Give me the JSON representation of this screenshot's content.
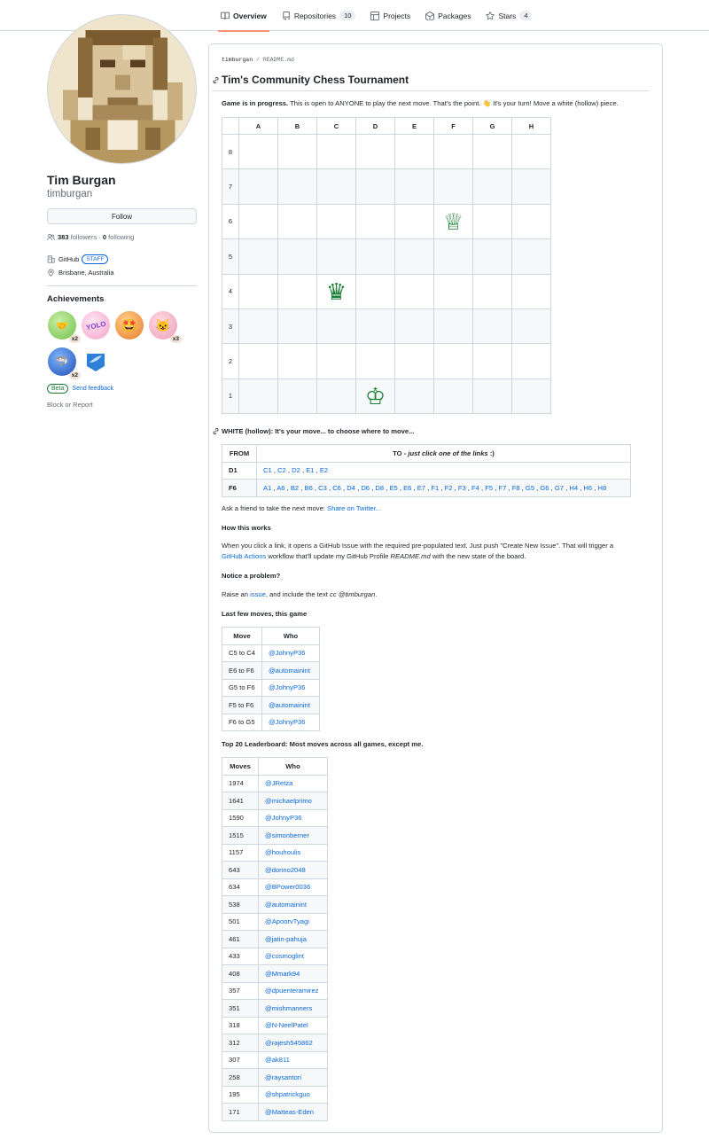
{
  "tabs": [
    {
      "label": "Overview",
      "icon": "book-icon",
      "count": ""
    },
    {
      "label": "Repositories",
      "icon": "repo-icon",
      "count": "10"
    },
    {
      "label": "Projects",
      "icon": "table-icon",
      "count": ""
    },
    {
      "label": "Packages",
      "icon": "package-icon",
      "count": ""
    },
    {
      "label": "Stars",
      "icon": "star-icon",
      "count": "4"
    }
  ],
  "profile": {
    "name": "Tim Burgan",
    "login": "timburgan",
    "follow_label": "Follow",
    "followers_count": "383",
    "followers_label": "followers",
    "sep": "·",
    "following_count": "0",
    "following_label": "following",
    "org": "GitHub",
    "staff_label": "STAFF",
    "location": "Brisbane, Australia",
    "achievements_title": "Achievements",
    "badges": [
      {
        "label": "x2",
        "text": "",
        "color": "#9fd67a"
      },
      {
        "label": "",
        "text": "YOLO",
        "color": "#f7c8e0"
      },
      {
        "label": "",
        "text": "",
        "color": "#f4a65a"
      },
      {
        "label": "x3",
        "text": "",
        "color": "#f0b8c8"
      },
      {
        "label": "x2",
        "text": "",
        "color": "#3b78d8"
      },
      {
        "label": "",
        "text": "",
        "color": "#ffffff"
      }
    ],
    "beta_label": "Beta",
    "feedback_label": "Send feedback",
    "block_label": "Block or Report"
  },
  "readme": {
    "crumb_user": "timburgan",
    "crumb_sep": "/",
    "crumb_file": "README.md",
    "title": "Tim's Community Chess Tournament",
    "status_bold": "Game is in progress.",
    "status_text": " This is open to ANYONE to play the next move. That's the point. 👋 It's your turn! Move a white (hollow) piece.",
    "board": {
      "files": [
        "A",
        "B",
        "C",
        "D",
        "E",
        "F",
        "G",
        "H"
      ],
      "ranks": [
        "8",
        "7",
        "6",
        "5",
        "4",
        "3",
        "2",
        "1"
      ],
      "pieces": [
        {
          "square": "F6",
          "glyph": "♕"
        },
        {
          "square": "C4",
          "glyph": "♛"
        },
        {
          "square": "D1",
          "glyph": "♔"
        }
      ]
    },
    "move_heading": "WHITE (hollow): It's your move... to choose where to move...",
    "moves_table": {
      "from_header": "FROM",
      "to_header_prefix": "TO - ",
      "to_header_em": "just click one of the links",
      "to_header_suffix": " :)",
      "rows": [
        {
          "from": "D1",
          "to": [
            "C1",
            "C2",
            "D2",
            "E1",
            "E2"
          ]
        },
        {
          "from": "F6",
          "to": [
            "A1",
            "A6",
            "B2",
            "B6",
            "C3",
            "C6",
            "D4",
            "D6",
            "D8",
            "E5",
            "E6",
            "E7",
            "F1",
            "F2",
            "F3",
            "F4",
            "F5",
            "F7",
            "F8",
            "G5",
            "G6",
            "G7",
            "H4",
            "H6",
            "H8"
          ]
        }
      ]
    },
    "share_text": "Ask a friend to take the next move: ",
    "share_link": "Share on Twitter...",
    "how_title": "How this works",
    "how_text_1": "When you click a link, it opens a GitHub Issue with the required pre-populated text. Just push \"Create New Issue\". That will trigger a",
    "how_link": "GitHub Actions",
    "how_text_2": " workflow that'll update my GitHub Profile ",
    "how_em": "README.md",
    "how_text_3": " with the new state of the board.",
    "problem_title": "Notice a problem?",
    "problem_text_1": "Raise an ",
    "problem_link": "issue",
    "problem_text_2": ", and include the text ",
    "problem_em": "cc @timburgan",
    "problem_text_3": ".",
    "last_title": "Last few moves, this game",
    "last_headers": [
      "Move",
      "Who"
    ],
    "last_moves": [
      {
        "move": "C5 to C4",
        "who": "@JohnyP36"
      },
      {
        "move": "E6 to F6",
        "who": "@automainint"
      },
      {
        "move": "G5 to F6",
        "who": "@JohnyP36"
      },
      {
        "move": "F5 to F6",
        "who": "@automainint"
      },
      {
        "move": "F6 to G5",
        "who": "@JohnyP36"
      }
    ],
    "lead_title": "Top 20 Leaderboard: Most moves across all games, except me.",
    "lead_headers": [
      "Moves",
      "Who"
    ],
    "leaderboard": [
      {
        "moves": "1974",
        "who": "@JRetza"
      },
      {
        "moves": "1641",
        "who": "@michaelprimo"
      },
      {
        "moves": "1590",
        "who": "@JohnyP36"
      },
      {
        "moves": "1515",
        "who": "@simonberner"
      },
      {
        "moves": "1157",
        "who": "@houhoulis"
      },
      {
        "moves": "643",
        "who": "@donno2048"
      },
      {
        "moves": "634",
        "who": "@BPower0036"
      },
      {
        "moves": "538",
        "who": "@automainint"
      },
      {
        "moves": "501",
        "who": "@ApoorvTyagi"
      },
      {
        "moves": "461",
        "who": "@jatin-pahuja"
      },
      {
        "moves": "433",
        "who": "@cosmoglint"
      },
      {
        "moves": "408",
        "who": "@Mmark94"
      },
      {
        "moves": "357",
        "who": "@dpuenteramirez"
      },
      {
        "moves": "351",
        "who": "@mishmanners"
      },
      {
        "moves": "318",
        "who": "@N-NeelPatel"
      },
      {
        "moves": "312",
        "who": "@rajesh545862"
      },
      {
        "moves": "307",
        "who": "@ak811"
      },
      {
        "moves": "258",
        "who": "@raysantori"
      },
      {
        "moves": "195",
        "who": "@shpatrickguo"
      },
      {
        "moves": "171",
        "who": "@Matteas-Eden"
      }
    ]
  }
}
